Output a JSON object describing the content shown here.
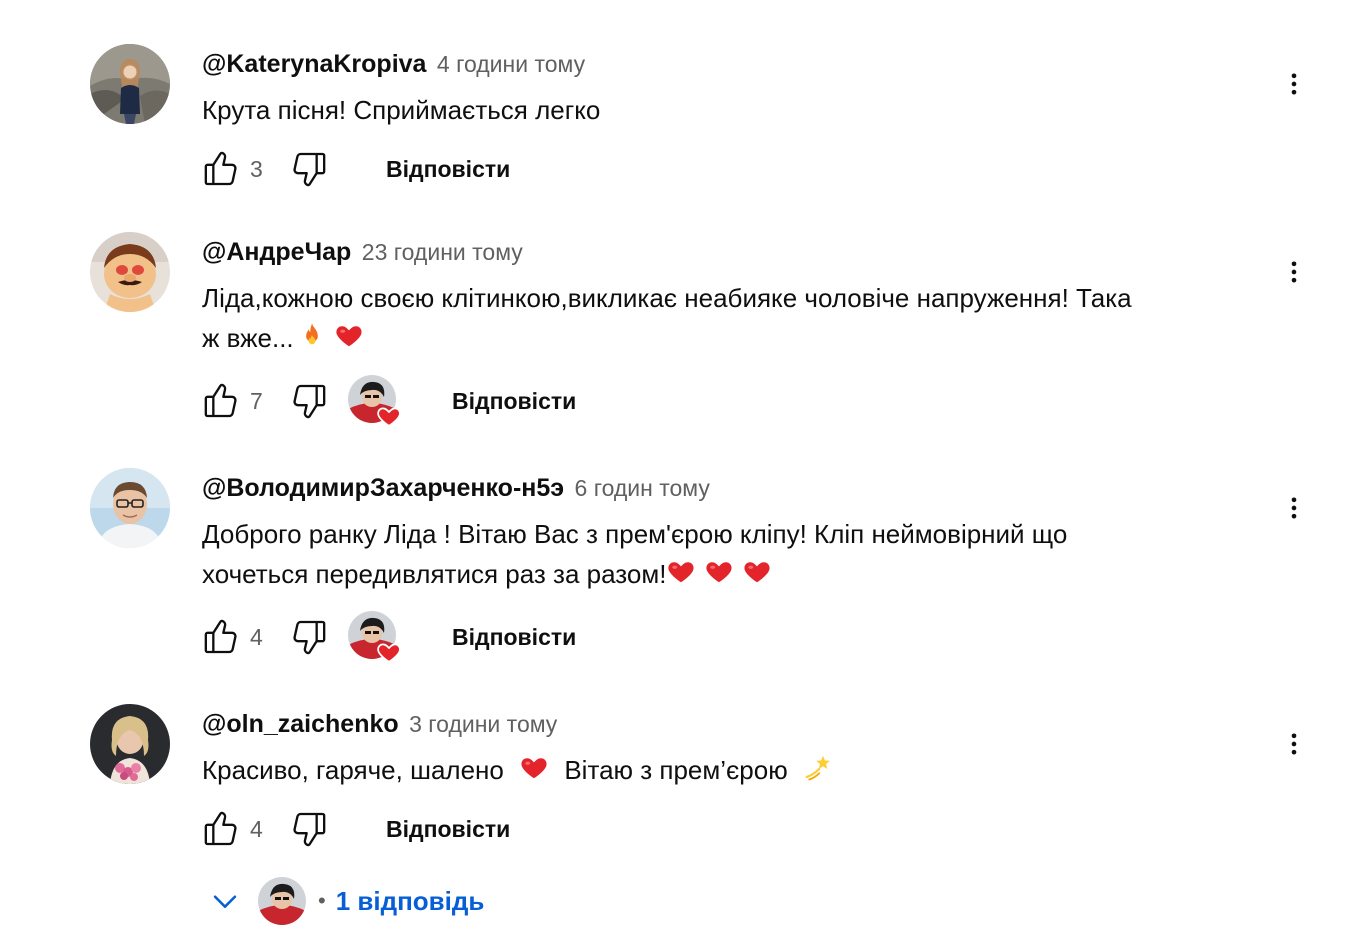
{
  "comments": [
    {
      "author": "@KaterynaKropiva",
      "time": "4 години тому",
      "text": "Крута пісня!  Сприймається легко",
      "likes": "3",
      "reply_label": "Відповісти",
      "creator_heart": false
    },
    {
      "author": "@АндреЧар",
      "time": "23 години тому",
      "text_line1": "Ліда,кожною своєю клітинкою,викликає неабияке чоловіче напруження! Така",
      "text_line2": "ж вже...",
      "likes": "7",
      "reply_label": "Відповісти",
      "creator_heart": true
    },
    {
      "author": "@ВолодимирЗахарченко-н5э",
      "time": "6 годин тому",
      "text_line1": "Доброго ранку Ліда ! Вітаю Вас з прем'єрою кліпу! Кліп неймовірний що",
      "text_line2": "хочеться передивлятися раз за разом!",
      "likes": "4",
      "reply_label": "Відповісти",
      "creator_heart": true
    },
    {
      "author": "@oln_zaichenko",
      "time": "3 години тому",
      "text_part1": "Красиво, гаряче, шалено",
      "text_part2": "Вітаю з прем’єрою",
      "likes": "4",
      "reply_label": "Відповісти",
      "creator_heart": false
    }
  ],
  "replies_toggle": {
    "bullet": "•",
    "label": "1 відповідь"
  },
  "icons": {
    "like": "thumbs-up-icon",
    "dislike": "thumbs-down-icon",
    "menu": "more-vertical-icon",
    "heart": "heart-icon",
    "fire": "fire-emoji",
    "dizzy": "dizzy-star-emoji",
    "chevron": "chevron-down-icon"
  },
  "colors": {
    "text": "#0f0f0f",
    "secondary": "#606060",
    "link": "#065fd4",
    "heart": "#e3242b"
  }
}
